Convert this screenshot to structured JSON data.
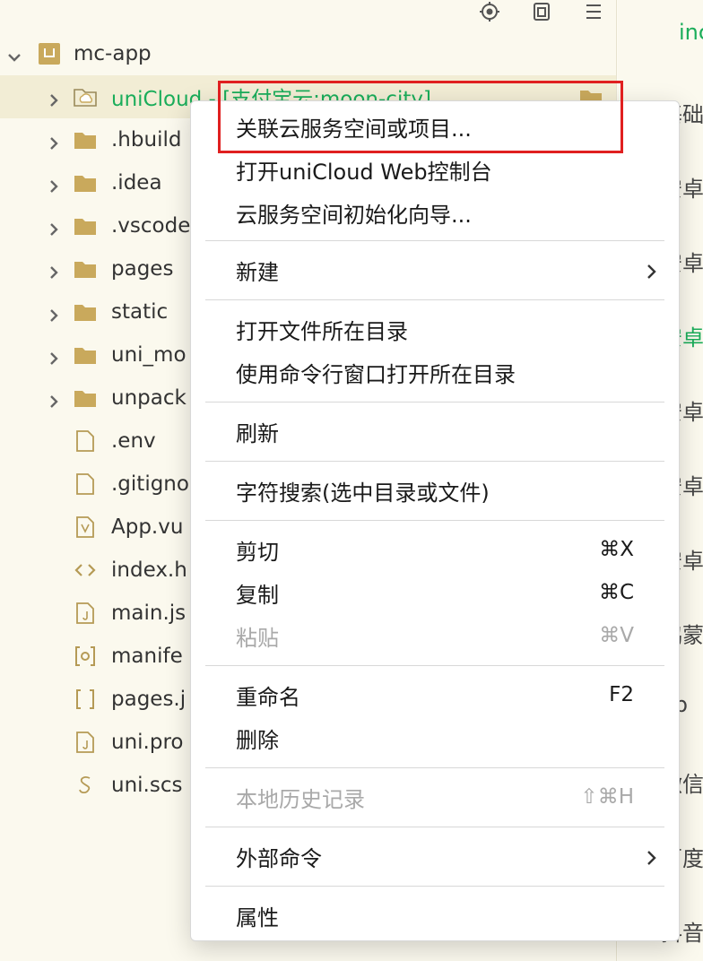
{
  "project": {
    "name": "mc-app",
    "items": [
      {
        "label": "uniCloud - [支付宝云:moon-city]",
        "type": "cloud-folder",
        "expanded": false
      },
      {
        "label": ".hbuild",
        "type": "folder"
      },
      {
        "label": ".idea",
        "type": "folder"
      },
      {
        "label": ".vscode",
        "type": "folder"
      },
      {
        "label": "pages",
        "type": "folder"
      },
      {
        "label": "static",
        "type": "folder"
      },
      {
        "label": "uni_mo",
        "type": "folder"
      },
      {
        "label": "unpack",
        "type": "folder"
      },
      {
        "label": ".env",
        "type": "file"
      },
      {
        "label": ".gitigno",
        "type": "file"
      },
      {
        "label": "App.vu",
        "type": "vue"
      },
      {
        "label": "index.h",
        "type": "html"
      },
      {
        "label": "main.js",
        "type": "js"
      },
      {
        "label": "manife",
        "type": "json-gear"
      },
      {
        "label": "pages.j",
        "type": "json"
      },
      {
        "label": "uni.pro",
        "type": "js"
      },
      {
        "label": "uni.scs",
        "type": "scss"
      }
    ]
  },
  "right_strip": {
    "top_text": "inc",
    "items": [
      {
        "text": "基础",
        "green": false
      },
      {
        "text": "安卓",
        "green": false
      },
      {
        "text": "安卓",
        "green": false
      },
      {
        "text": "安卓",
        "green": true
      },
      {
        "text": "安卓",
        "green": false
      },
      {
        "text": "安卓",
        "green": false
      },
      {
        "text": "安卓",
        "green": false
      },
      {
        "text": "鸿蒙",
        "green": false
      },
      {
        "text": "eb",
        "green": false
      },
      {
        "text": "微信",
        "green": false
      },
      {
        "text": "百度",
        "green": false
      },
      {
        "text": "抖音",
        "green": false
      }
    ]
  },
  "menu": {
    "items": [
      {
        "label": "关联云服务空间或项目...",
        "shortcut": "",
        "disabled": false,
        "submenu": false,
        "highlighted": true
      },
      {
        "label": "打开uniCloud Web控制台",
        "shortcut": "",
        "disabled": false,
        "submenu": false
      },
      {
        "label": "云服务空间初始化向导...",
        "shortcut": "",
        "disabled": false,
        "submenu": false
      },
      {
        "label": "新建",
        "shortcut": "",
        "disabled": false,
        "submenu": true
      },
      {
        "label": "打开文件所在目录",
        "shortcut": "",
        "disabled": false,
        "submenu": false
      },
      {
        "label": "使用命令行窗口打开所在目录",
        "shortcut": "",
        "disabled": false,
        "submenu": false
      },
      {
        "label": "刷新",
        "shortcut": "",
        "disabled": false,
        "submenu": false
      },
      {
        "label": "字符搜索(选中目录或文件)",
        "shortcut": "",
        "disabled": false,
        "submenu": false
      },
      {
        "label": "剪切",
        "shortcut": "⌘X",
        "disabled": false,
        "submenu": false
      },
      {
        "label": "复制",
        "shortcut": "⌘C",
        "disabled": false,
        "submenu": false
      },
      {
        "label": "粘贴",
        "shortcut": "⌘V",
        "disabled": true,
        "submenu": false
      },
      {
        "label": "重命名",
        "shortcut": "F2",
        "disabled": false,
        "submenu": false
      },
      {
        "label": "删除",
        "shortcut": "",
        "disabled": false,
        "submenu": false
      },
      {
        "label": "本地历史记录",
        "shortcut": "⇧⌘H",
        "disabled": true,
        "submenu": false
      },
      {
        "label": "外部命令",
        "shortcut": "",
        "disabled": false,
        "submenu": true
      },
      {
        "label": "属性",
        "shortcut": "",
        "disabled": false,
        "submenu": false
      }
    ]
  },
  "colors": {
    "accent_green": "#1aad5a",
    "highlight_red": "#e02020",
    "folder": "#c9a95c"
  }
}
